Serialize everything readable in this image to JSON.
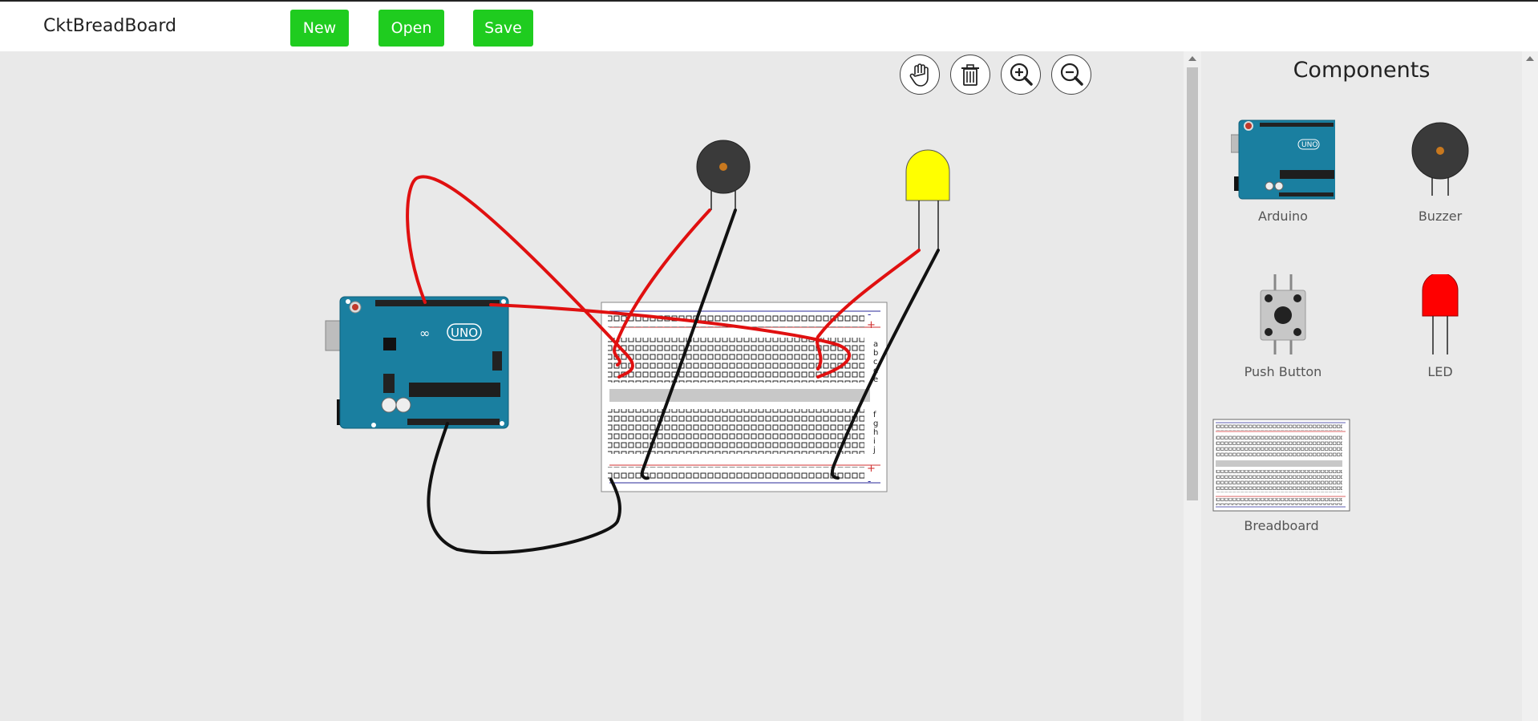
{
  "app": {
    "title": "CktBreadBoard"
  },
  "toolbar": {
    "new_label": "New",
    "open_label": "Open",
    "save_label": "Save"
  },
  "tools": [
    "hand-icon",
    "trash-icon",
    "zoom-in-icon",
    "zoom-out-icon"
  ],
  "canvas": {
    "board_label": "UNO",
    "breadboard_rows_top": [
      "a",
      "b",
      "c",
      "d",
      "e"
    ],
    "breadboard_rows_bottom": [
      "f",
      "g",
      "h",
      "i",
      "j"
    ],
    "rail_plus": "+",
    "rail_minus": "-",
    "wire_colors": {
      "signal": "#e01010",
      "ground": "#111111"
    }
  },
  "panel": {
    "title": "Components",
    "items": [
      {
        "label": "Arduino"
      },
      {
        "label": "Buzzer"
      },
      {
        "label": "Push Button"
      },
      {
        "label": "LED"
      },
      {
        "label": "Breadboard"
      }
    ]
  },
  "colors": {
    "button": "#1fcc1f",
    "arduino": "#1a7fa0",
    "led_canvas": "#ffff00",
    "led_panel": "#ff0000"
  }
}
